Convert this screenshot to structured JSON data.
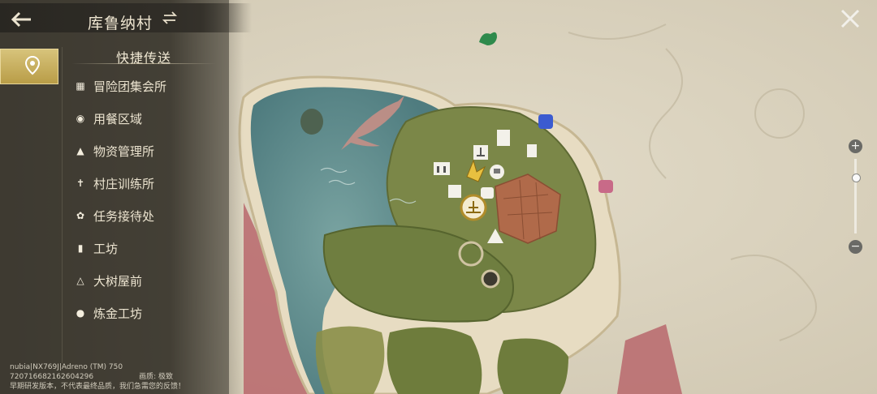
{
  "header": {
    "region_name": "库鲁纳村",
    "back_icon": "arrow-left-icon",
    "switch_icon": "swap-arrows-icon"
  },
  "quick_travel": {
    "title": "快捷传送",
    "items": [
      {
        "label": "冒险团集会所",
        "icon": "guild-icon"
      },
      {
        "label": "用餐区域",
        "icon": "dining-icon"
      },
      {
        "label": "物资管理所",
        "icon": "supply-icon"
      },
      {
        "label": "村庄训练所",
        "icon": "training-icon"
      },
      {
        "label": "任务接待处",
        "icon": "paw-icon"
      },
      {
        "label": "工坊",
        "icon": "workshop-icon"
      },
      {
        "label": "大树屋前",
        "icon": "treehouse-icon"
      },
      {
        "label": "炼金工坊",
        "icon": "alchemy-icon"
      }
    ]
  },
  "device_info": {
    "line1": "nubia|NX769J|Adreno (TM) 750",
    "line2": "720716682162604296",
    "quality_label": "画质: 极致",
    "line3": "早期研发版本，不代表最终品质，我们急需您的反馈！"
  },
  "zoom": {
    "in_label": "+",
    "out_label": "−",
    "level": 0.0
  },
  "colors": {
    "accent_gold": "#c9b062",
    "panel_bg": "#3c3830",
    "text": "#ece4d0",
    "sea": "#5f8a8a",
    "land": "#6b7a42"
  }
}
